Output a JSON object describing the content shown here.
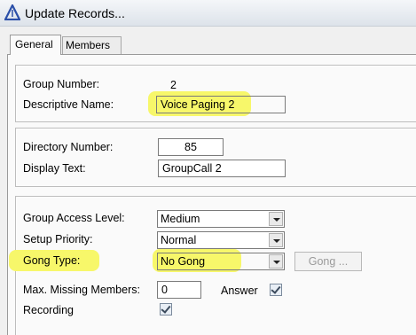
{
  "window": {
    "title": "Update Records..."
  },
  "tabs": [
    {
      "label": "General",
      "active": true
    },
    {
      "label": "Members",
      "active": false
    }
  ],
  "general": {
    "group_number_label": "Group Number:",
    "group_number_value": "2",
    "descriptive_name_label": "Descriptive Name:",
    "descriptive_name_value": "Voice Paging 2",
    "directory_number_label": "Directory Number:",
    "directory_number_value": "85",
    "display_text_label": "Display Text:",
    "display_text_value": "GroupCall 2",
    "group_access_level_label": "Group Access Level:",
    "group_access_level_value": "Medium",
    "setup_priority_label": "Setup Priority:",
    "setup_priority_value": "Normal",
    "gong_type_label": "Gong Type:",
    "gong_type_value": "No Gong",
    "gong_button_label": "Gong ...",
    "max_missing_label": "Max. Missing Members:",
    "max_missing_value": "0",
    "answer_label": "Answer",
    "answer_checked": true,
    "recording_label": "Recording",
    "recording_checked": true
  },
  "colors": {
    "highlight": "#f7f76a",
    "title_icon": "#2b4fa8"
  }
}
